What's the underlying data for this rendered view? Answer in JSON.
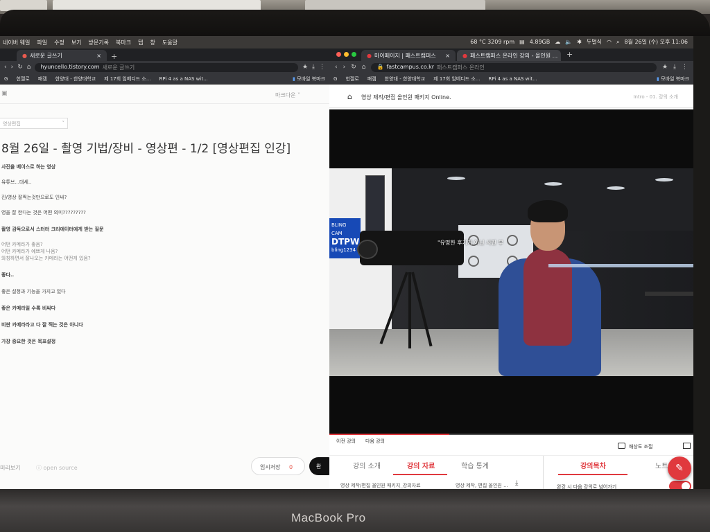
{
  "menubar": {
    "left_items": [
      "네이버 웨일",
      "파일",
      "수정",
      "보기",
      "방문기록",
      "북마크",
      "탭",
      "창",
      "도움말"
    ],
    "temp": "68 °C 3209 rpm",
    "memory": "4.89GB",
    "input_source": "두벌식",
    "datetime": "8월 26일 (수) 오후 11:06"
  },
  "left_browser": {
    "tab_title": "새로운 글쓰기",
    "url": "hyuncello.tistory.com",
    "url_suffix": "새로운 글쓰기",
    "bookmarks": [
      "G",
      "헌젤로",
      "패캠",
      "한양대 - 한양대학교",
      "제 17회 임베디드 소...",
      "RPi 4 as a NAS wit..."
    ],
    "bookmark_folder": "모바일 북마크"
  },
  "editor": {
    "markdown_label": "마크다운",
    "category": "영상편집",
    "title": "8월 26일 - 촬영 기법/장비 - 영상편 - 1/2 [영상편집 인강]",
    "lines": [
      {
        "text": "사진을 베이스로 하는 영상",
        "style": "bold"
      },
      {
        "text": "유튜브...대세..",
        "style": "normal"
      },
      {
        "text": "진/영상 잘찍는것만으로도 인싸?",
        "style": "normal"
      },
      {
        "text": "영을 잘 한다는 것은 어떤 의미?????????",
        "style": "normal"
      },
      {
        "text": "촬영 감독으로서 스터터 크리에이터에게 받는 질문",
        "style": "bold"
      },
      {
        "text": "어떤 카메라가 좋음?",
        "style": "light"
      },
      {
        "text": "어떤 카메라가 예쁘게 나옴?",
        "style": "light"
      },
      {
        "text": "와칭하면서 잘나오는 카메라는 어떤게 있음?",
        "style": "light"
      },
      {
        "text": "좋다..",
        "style": "bold"
      },
      {
        "text": "좋은 설정과 기능을 가지고 있다",
        "style": "normal"
      },
      {
        "text": "좋은 카메라일 수록 비싸다",
        "style": "bold"
      },
      {
        "text": "비싼 카메라라고 다 잘 찍는 것은 아니다",
        "style": "bold"
      },
      {
        "text": "가장 중요한 것은 목표설정",
        "style": "bold"
      }
    ],
    "preview_label": "미리보기",
    "open_source_label": "open source",
    "save_label": "임시저장",
    "save_count": "0",
    "publish_label": "완"
  },
  "right_browser": {
    "tabs": [
      "마이페이지 | 패스트캠퍼스",
      "패스트캠퍼스 온라인 강의 - 올인원 ..."
    ],
    "url": "fastcampus.co.kr",
    "url_suffix": "패스트캠퍼스 온라인"
  },
  "lecture": {
    "title": "영상 제작/편집 올인원 패키지 Online.",
    "crumb": "Intro - 01. 강의 소개",
    "subtitle": "\"유명한 후기가 아닌 사진 부",
    "sign_text": [
      "BLING CAM",
      "DTPW",
      "bling1234"
    ],
    "progress": 0.33,
    "prev_label": "이전 강의",
    "next_label": "다음 강의",
    "resolution_label": "해상도 조절",
    "tabs": [
      "강의 소개",
      "강의 자료",
      "학습 통계"
    ],
    "active_tab": "강의 자료",
    "toc_tabs": [
      "강의목차",
      "노트"
    ],
    "file_name": "영상 제작/편집 올인원 패키지_강의자료",
    "file_name2": "영상 제작, 편집 올인원 ...",
    "autoplay_label": "완강 시 다음 강의로 넘어가기"
  },
  "device": {
    "label": "MacBook Pro"
  }
}
